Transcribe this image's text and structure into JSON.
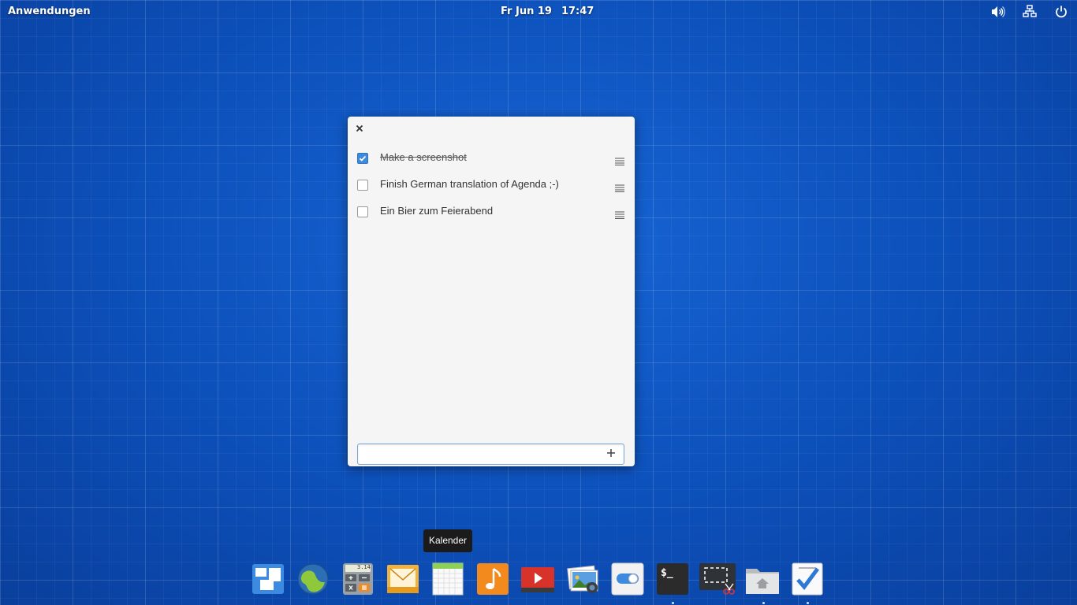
{
  "panel": {
    "apps_label": "Anwendungen",
    "date": "Fr Jun 19",
    "time": "17:47",
    "indicators": [
      "volume-icon",
      "network-icon",
      "power-icon"
    ]
  },
  "window": {
    "close_icon": "close-icon",
    "tasks": [
      {
        "label": "Make a screenshot",
        "done": true
      },
      {
        "label": "Finish German translation of Agenda ;-)",
        "done": false
      },
      {
        "label": "Ein Bier zum Feierabend",
        "done": false
      }
    ],
    "new_task": {
      "value": "",
      "placeholder": "",
      "add_icon": "plus-icon"
    }
  },
  "tooltip": "Kalender",
  "dock": {
    "items": [
      "multitasking-view-icon",
      "web-browser-icon",
      "calculator-icon",
      "mail-icon",
      "calendar-icon",
      "music-icon",
      "videos-icon",
      "photos-icon",
      "system-settings-icon",
      "terminal-icon",
      "screenshot-icon",
      "files-icon",
      "agenda-icon"
    ],
    "calculator_display": "3.14",
    "terminal_prompt": "$_"
  },
  "colors": {
    "desktop": "#0e52bf",
    "checkbox_checked": "#3d8bdd",
    "window_bg": "#f5f5f5"
  }
}
